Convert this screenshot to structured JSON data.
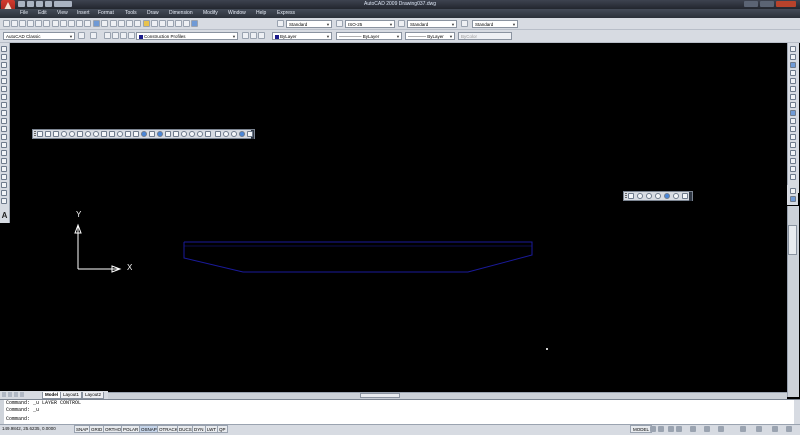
{
  "window": {
    "title": "AutoCAD 2009  Drawing037.dwg"
  },
  "menu": [
    "File",
    "Edit",
    "View",
    "Insert",
    "Format",
    "Tools",
    "Draw",
    "Dimension",
    "Modify",
    "Window",
    "Help",
    "Express"
  ],
  "toolbar_row1": {
    "text_style": "Standard",
    "dim_style": "ISO-25",
    "table_style": "Standard",
    "mleader_style": "Standard"
  },
  "toolbar_row2": {
    "workspace": "AutoCAD Classic",
    "layer": "Construction Profiles",
    "color": "ByLayer",
    "linetype": "ByLayer",
    "lineweight": "ByLayer",
    "plot_style": "ByColor"
  },
  "ucs": {
    "x_label": "X",
    "y_label": "Y"
  },
  "tabs": [
    "Model",
    "Layout1",
    "Layout2"
  ],
  "command_lines": [
    "Command: _u LAYER CONTROL",
    "Command: _u",
    "Command:"
  ],
  "status": {
    "coordinates": "149.9842, 25.6235, 0.0000",
    "toggles": [
      "SNAP",
      "GRID",
      "ORTHO",
      "POLAR",
      "OSNAP",
      "OTRACK",
      "DUCS",
      "DYN",
      "LWT",
      "QP"
    ],
    "toggles_on": [
      "OSNAP"
    ],
    "model_label": "MODEL"
  },
  "colors": {
    "canvas": "#000000",
    "profile_stroke": "#1a1a9a",
    "ucs_icon": "#ffffff",
    "titlebar": "#2b3039"
  }
}
